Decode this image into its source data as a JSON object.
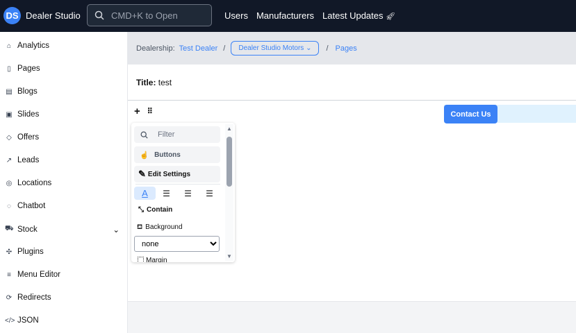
{
  "header": {
    "logo": "DS",
    "brand": "Dealer Studio",
    "search_placeholder": "CMD+K to Open",
    "nav": [
      "Users",
      "Manufacturers",
      "Latest Updates"
    ]
  },
  "sidebar": {
    "items": [
      {
        "label": "Analytics",
        "icon": "home-icon"
      },
      {
        "label": "Pages",
        "icon": "file-icon"
      },
      {
        "label": "Blogs",
        "icon": "newspaper-icon"
      },
      {
        "label": "Slides",
        "icon": "images-icon"
      },
      {
        "label": "Offers",
        "icon": "tag-icon"
      },
      {
        "label": "Leads",
        "icon": "trend-icon"
      },
      {
        "label": "Locations",
        "icon": "pin-icon"
      },
      {
        "label": "Chatbot",
        "icon": "chat-icon"
      },
      {
        "label": "Stock",
        "icon": "car-icon"
      },
      {
        "label": "Plugins",
        "icon": "puzzle-icon"
      },
      {
        "label": "Menu Editor",
        "icon": "menu-icon"
      },
      {
        "label": "Redirects",
        "icon": "redirect-icon"
      },
      {
        "label": "JSON",
        "icon": "code-icon"
      }
    ]
  },
  "breadcrumb": {
    "label": "Dealership:",
    "dealer": "Test Dealer",
    "site": "Dealer Studio Motors",
    "page": "Pages",
    "sep": "/"
  },
  "title": {
    "label": "Title:",
    "value": "test"
  },
  "editor": {
    "add": "+",
    "drag": "⠿",
    "filter_placeholder": "Filter",
    "buttons": "Buttons",
    "edit_settings": "Edit Settings",
    "contain": "Contain",
    "background": "Background",
    "bg_value": "none",
    "margin": "Margin"
  },
  "canvas": {
    "cta": "Contact Us"
  }
}
